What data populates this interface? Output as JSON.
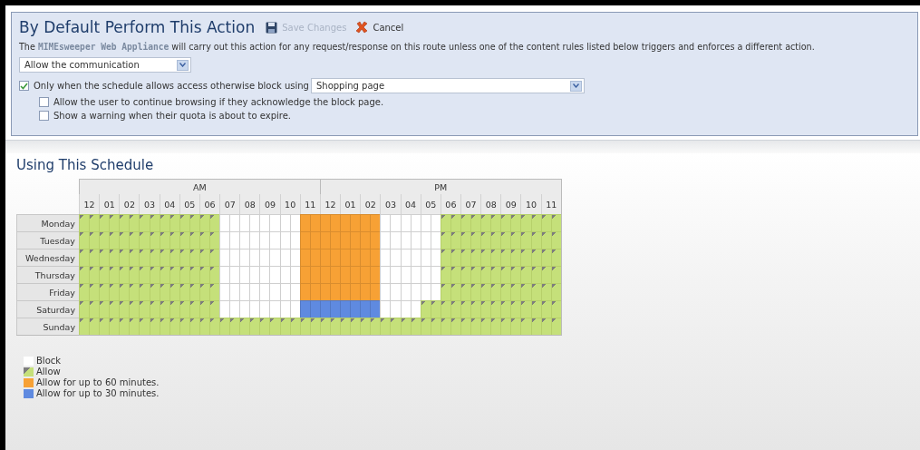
{
  "action_panel": {
    "title": "By Default Perform This Action",
    "save_button": {
      "label": "Save Changes",
      "disabled": true
    },
    "cancel_button": {
      "label": "Cancel"
    },
    "description": "The **MIMEsweeper Web Appliance** will carry out this action for any request/response on this route unless one of the content rules listed below triggers and enforces a different action.",
    "action_select": {
      "value": "Allow the communication"
    },
    "options": [
      {
        "label": "Only when the schedule allows access otherwise block using",
        "checked": true,
        "kind": "with-select",
        "select_value": "Shopping page"
      },
      {
        "label": "Allow the user to continue browsing if they acknowledge the block page.",
        "checked": false,
        "kind": "plain"
      },
      {
        "label": "Show a warning when their quota is about to expire.",
        "checked": false,
        "kind": "plain"
      }
    ]
  },
  "schedule": {
    "title": "Using This Schedule",
    "periods": [
      "AM",
      "PM"
    ],
    "hours": [
      "12",
      "01",
      "02",
      "03",
      "04",
      "05",
      "06",
      "07",
      "08",
      "09",
      "10",
      "11",
      "12",
      "01",
      "02",
      "03",
      "04",
      "05",
      "06",
      "07",
      "08",
      "09",
      "10",
      "11"
    ],
    "days": [
      {
        "name": "Monday",
        "slots": [
          {
            "kind": "allow"
          },
          {
            "kind": "allow"
          },
          {
            "kind": "allow"
          },
          {
            "kind": "allow"
          },
          {
            "kind": "allow"
          },
          {
            "kind": "allow"
          },
          {
            "kind": "allow"
          },
          {
            "kind": "allow"
          },
          {
            "kind": "allow"
          },
          {
            "kind": "allow"
          },
          {
            "kind": "allow"
          },
          {
            "kind": "allow"
          },
          {
            "kind": "allow"
          },
          {
            "kind": "allow"
          },
          {
            "kind": "block"
          },
          {
            "kind": "block"
          },
          {
            "kind": "block"
          },
          {
            "kind": "block"
          },
          {
            "kind": "block"
          },
          {
            "kind": "block"
          },
          {
            "kind": "block"
          },
          {
            "kind": "block"
          },
          {
            "kind": "limit60"
          },
          {
            "kind": "limit60"
          },
          {
            "kind": "limit60"
          },
          {
            "kind": "limit60"
          },
          {
            "kind": "limit60"
          },
          {
            "kind": "limit60"
          },
          {
            "kind": "limit60"
          },
          {
            "kind": "limit60"
          },
          {
            "kind": "block"
          },
          {
            "kind": "block"
          },
          {
            "kind": "block"
          },
          {
            "kind": "block"
          },
          {
            "kind": "block"
          },
          {
            "kind": "block"
          },
          {
            "kind": "allow"
          },
          {
            "kind": "allow"
          },
          {
            "kind": "allow"
          },
          {
            "kind": "allow"
          },
          {
            "kind": "allow"
          },
          {
            "kind": "allow"
          },
          {
            "kind": "allow"
          },
          {
            "kind": "allow"
          },
          {
            "kind": "allow"
          },
          {
            "kind": "allow"
          },
          {
            "kind": "allow"
          },
          {
            "kind": "allow"
          }
        ]
      },
      {
        "name": "Tuesday",
        "slots": [
          {
            "kind": "allow"
          },
          {
            "kind": "allow"
          },
          {
            "kind": "allow"
          },
          {
            "kind": "allow"
          },
          {
            "kind": "allow"
          },
          {
            "kind": "allow"
          },
          {
            "kind": "allow"
          },
          {
            "kind": "allow"
          },
          {
            "kind": "allow"
          },
          {
            "kind": "allow"
          },
          {
            "kind": "allow"
          },
          {
            "kind": "allow"
          },
          {
            "kind": "allow"
          },
          {
            "kind": "allow"
          },
          {
            "kind": "block"
          },
          {
            "kind": "block"
          },
          {
            "kind": "block"
          },
          {
            "kind": "block"
          },
          {
            "kind": "block"
          },
          {
            "kind": "block"
          },
          {
            "kind": "block"
          },
          {
            "kind": "block"
          },
          {
            "kind": "limit60"
          },
          {
            "kind": "limit60"
          },
          {
            "kind": "limit60"
          },
          {
            "kind": "limit60"
          },
          {
            "kind": "limit60"
          },
          {
            "kind": "limit60"
          },
          {
            "kind": "limit60"
          },
          {
            "kind": "limit60"
          },
          {
            "kind": "block"
          },
          {
            "kind": "block"
          },
          {
            "kind": "block"
          },
          {
            "kind": "block"
          },
          {
            "kind": "block"
          },
          {
            "kind": "block"
          },
          {
            "kind": "allow"
          },
          {
            "kind": "allow"
          },
          {
            "kind": "allow"
          },
          {
            "kind": "allow"
          },
          {
            "kind": "allow"
          },
          {
            "kind": "allow"
          },
          {
            "kind": "allow"
          },
          {
            "kind": "allow"
          },
          {
            "kind": "allow"
          },
          {
            "kind": "allow"
          },
          {
            "kind": "allow"
          },
          {
            "kind": "allow"
          }
        ]
      },
      {
        "name": "Wednesday",
        "slots": [
          {
            "kind": "allow"
          },
          {
            "kind": "allow"
          },
          {
            "kind": "allow"
          },
          {
            "kind": "allow"
          },
          {
            "kind": "allow"
          },
          {
            "kind": "allow"
          },
          {
            "kind": "allow"
          },
          {
            "kind": "allow"
          },
          {
            "kind": "allow"
          },
          {
            "kind": "allow"
          },
          {
            "kind": "allow"
          },
          {
            "kind": "allow"
          },
          {
            "kind": "allow"
          },
          {
            "kind": "allow"
          },
          {
            "kind": "block"
          },
          {
            "kind": "block"
          },
          {
            "kind": "block"
          },
          {
            "kind": "block"
          },
          {
            "kind": "block"
          },
          {
            "kind": "block"
          },
          {
            "kind": "block"
          },
          {
            "kind": "block"
          },
          {
            "kind": "limit60"
          },
          {
            "kind": "limit60"
          },
          {
            "kind": "limit60"
          },
          {
            "kind": "limit60"
          },
          {
            "kind": "limit60"
          },
          {
            "kind": "limit60"
          },
          {
            "kind": "limit60"
          },
          {
            "kind": "limit60"
          },
          {
            "kind": "block"
          },
          {
            "kind": "block"
          },
          {
            "kind": "block"
          },
          {
            "kind": "block"
          },
          {
            "kind": "block"
          },
          {
            "kind": "block"
          },
          {
            "kind": "allow"
          },
          {
            "kind": "allow"
          },
          {
            "kind": "allow"
          },
          {
            "kind": "allow"
          },
          {
            "kind": "allow"
          },
          {
            "kind": "allow"
          },
          {
            "kind": "allow"
          },
          {
            "kind": "allow"
          },
          {
            "kind": "allow"
          },
          {
            "kind": "allow"
          },
          {
            "kind": "allow"
          },
          {
            "kind": "allow"
          }
        ]
      },
      {
        "name": "Thursday",
        "slots": [
          {
            "kind": "allow"
          },
          {
            "kind": "allow"
          },
          {
            "kind": "allow"
          },
          {
            "kind": "allow"
          },
          {
            "kind": "allow"
          },
          {
            "kind": "allow"
          },
          {
            "kind": "allow"
          },
          {
            "kind": "allow"
          },
          {
            "kind": "allow"
          },
          {
            "kind": "allow"
          },
          {
            "kind": "allow"
          },
          {
            "kind": "allow"
          },
          {
            "kind": "allow"
          },
          {
            "kind": "allow"
          },
          {
            "kind": "block"
          },
          {
            "kind": "block"
          },
          {
            "kind": "block"
          },
          {
            "kind": "block"
          },
          {
            "kind": "block"
          },
          {
            "kind": "block"
          },
          {
            "kind": "block"
          },
          {
            "kind": "block"
          },
          {
            "kind": "limit60"
          },
          {
            "kind": "limit60"
          },
          {
            "kind": "limit60"
          },
          {
            "kind": "limit60"
          },
          {
            "kind": "limit60"
          },
          {
            "kind": "limit60"
          },
          {
            "kind": "limit60"
          },
          {
            "kind": "limit60"
          },
          {
            "kind": "block"
          },
          {
            "kind": "block"
          },
          {
            "kind": "block"
          },
          {
            "kind": "block"
          },
          {
            "kind": "block"
          },
          {
            "kind": "block"
          },
          {
            "kind": "allow"
          },
          {
            "kind": "allow"
          },
          {
            "kind": "allow"
          },
          {
            "kind": "allow"
          },
          {
            "kind": "allow"
          },
          {
            "kind": "allow"
          },
          {
            "kind": "allow"
          },
          {
            "kind": "allow"
          },
          {
            "kind": "allow"
          },
          {
            "kind": "allow"
          },
          {
            "kind": "allow"
          },
          {
            "kind": "allow"
          }
        ]
      },
      {
        "name": "Friday",
        "slots": [
          {
            "kind": "allow"
          },
          {
            "kind": "allow"
          },
          {
            "kind": "allow"
          },
          {
            "kind": "allow"
          },
          {
            "kind": "allow"
          },
          {
            "kind": "allow"
          },
          {
            "kind": "allow"
          },
          {
            "kind": "allow"
          },
          {
            "kind": "allow"
          },
          {
            "kind": "allow"
          },
          {
            "kind": "allow"
          },
          {
            "kind": "allow"
          },
          {
            "kind": "allow"
          },
          {
            "kind": "allow"
          },
          {
            "kind": "block"
          },
          {
            "kind": "block"
          },
          {
            "kind": "block"
          },
          {
            "kind": "block"
          },
          {
            "kind": "block"
          },
          {
            "kind": "block"
          },
          {
            "kind": "block"
          },
          {
            "kind": "block"
          },
          {
            "kind": "limit60"
          },
          {
            "kind": "limit60"
          },
          {
            "kind": "limit60"
          },
          {
            "kind": "limit60"
          },
          {
            "kind": "limit60"
          },
          {
            "kind": "limit60"
          },
          {
            "kind": "limit60"
          },
          {
            "kind": "limit60"
          },
          {
            "kind": "block"
          },
          {
            "kind": "block"
          },
          {
            "kind": "block"
          },
          {
            "kind": "block"
          },
          {
            "kind": "block"
          },
          {
            "kind": "block"
          },
          {
            "kind": "allow"
          },
          {
            "kind": "allow"
          },
          {
            "kind": "allow"
          },
          {
            "kind": "allow"
          },
          {
            "kind": "allow"
          },
          {
            "kind": "allow"
          },
          {
            "kind": "allow"
          },
          {
            "kind": "allow"
          },
          {
            "kind": "allow"
          },
          {
            "kind": "allow"
          },
          {
            "kind": "allow"
          },
          {
            "kind": "allow"
          }
        ]
      },
      {
        "name": "Saturday",
        "slots": [
          {
            "kind": "allow"
          },
          {
            "kind": "allow"
          },
          {
            "kind": "allow"
          },
          {
            "kind": "allow"
          },
          {
            "kind": "allow"
          },
          {
            "kind": "allow"
          },
          {
            "kind": "allow"
          },
          {
            "kind": "allow"
          },
          {
            "kind": "allow"
          },
          {
            "kind": "allow"
          },
          {
            "kind": "allow"
          },
          {
            "kind": "allow"
          },
          {
            "kind": "allow"
          },
          {
            "kind": "allow"
          },
          {
            "kind": "block"
          },
          {
            "kind": "block"
          },
          {
            "kind": "block"
          },
          {
            "kind": "block"
          },
          {
            "kind": "block"
          },
          {
            "kind": "block"
          },
          {
            "kind": "block"
          },
          {
            "kind": "block"
          },
          {
            "kind": "limit30"
          },
          {
            "kind": "limit30"
          },
          {
            "kind": "limit30"
          },
          {
            "kind": "limit30"
          },
          {
            "kind": "limit30"
          },
          {
            "kind": "limit30"
          },
          {
            "kind": "limit30"
          },
          {
            "kind": "limit30"
          },
          {
            "kind": "block"
          },
          {
            "kind": "block"
          },
          {
            "kind": "block"
          },
          {
            "kind": "block"
          },
          {
            "kind": "allow"
          },
          {
            "kind": "allow"
          },
          {
            "kind": "allow"
          },
          {
            "kind": "allow"
          },
          {
            "kind": "allow"
          },
          {
            "kind": "allow"
          },
          {
            "kind": "allow"
          },
          {
            "kind": "allow"
          },
          {
            "kind": "allow"
          },
          {
            "kind": "allow"
          },
          {
            "kind": "allow"
          },
          {
            "kind": "allow"
          },
          {
            "kind": "allow"
          },
          {
            "kind": "allow"
          }
        ]
      },
      {
        "name": "Sunday",
        "slots": [
          {
            "kind": "allow"
          },
          {
            "kind": "allow"
          },
          {
            "kind": "allow"
          },
          {
            "kind": "allow"
          },
          {
            "kind": "allow"
          },
          {
            "kind": "allow"
          },
          {
            "kind": "allow"
          },
          {
            "kind": "allow"
          },
          {
            "kind": "allow"
          },
          {
            "kind": "allow"
          },
          {
            "kind": "allow"
          },
          {
            "kind": "allow"
          },
          {
            "kind": "allow"
          },
          {
            "kind": "allow"
          },
          {
            "kind": "allow"
          },
          {
            "kind": "allow"
          },
          {
            "kind": "allow"
          },
          {
            "kind": "allow"
          },
          {
            "kind": "allow"
          },
          {
            "kind": "allow"
          },
          {
            "kind": "allow"
          },
          {
            "kind": "allow"
          },
          {
            "kind": "allow"
          },
          {
            "kind": "allow"
          },
          {
            "kind": "allow"
          },
          {
            "kind": "allow"
          },
          {
            "kind": "allow"
          },
          {
            "kind": "allow"
          },
          {
            "kind": "allow"
          },
          {
            "kind": "allow"
          },
          {
            "kind": "allow"
          },
          {
            "kind": "allow"
          },
          {
            "kind": "allow"
          },
          {
            "kind": "allow"
          },
          {
            "kind": "allow"
          },
          {
            "kind": "allow"
          },
          {
            "kind": "allow"
          },
          {
            "kind": "allow"
          },
          {
            "kind": "allow"
          },
          {
            "kind": "allow"
          },
          {
            "kind": "allow"
          },
          {
            "kind": "allow"
          },
          {
            "kind": "allow"
          },
          {
            "kind": "allow"
          },
          {
            "kind": "allow"
          },
          {
            "kind": "allow"
          },
          {
            "kind": "allow"
          },
          {
            "kind": "allow"
          }
        ]
      }
    ],
    "legend": [
      {
        "label": "Block",
        "kind": "block",
        "color": "#ffffff"
      },
      {
        "label": "Allow",
        "kind": "allow",
        "color": "#c5e07a"
      },
      {
        "label": "Allow for up to 60 minutes.",
        "kind": "limit60",
        "color": "#f7a135"
      },
      {
        "label": "Allow for up to 30 minutes.",
        "kind": "limit30",
        "color": "#5f8ae0"
      }
    ]
  }
}
